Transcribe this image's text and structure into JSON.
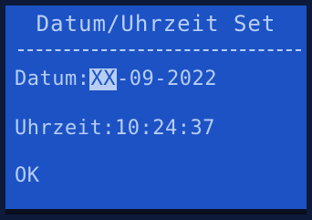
{
  "title": "Datum/Uhrzeit Set",
  "date": {
    "label": "Datum:",
    "day": "XX",
    "rest": "-09-2022"
  },
  "time": {
    "label": "Uhrzeit:",
    "value": "10:24:37"
  },
  "ok": {
    "label": "OK"
  },
  "colors": {
    "background": "#1c52c4",
    "text": "#b7cdf4"
  }
}
